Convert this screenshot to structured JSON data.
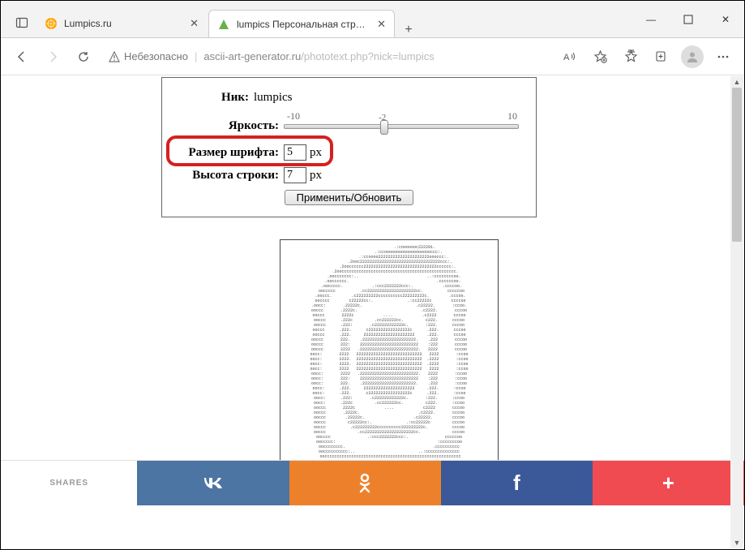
{
  "tabs": [
    {
      "title": "Lumpics.ru",
      "active": false
    },
    {
      "title": "lumpics Персональная странич",
      "active": true
    }
  ],
  "newtab_glyph": "+",
  "window": {
    "min": "—",
    "max": "▢",
    "close": "✕"
  },
  "toolbar": {
    "insecure": "Небезопасно",
    "url_host": "ascii-art-generator.ru",
    "url_path": "/phototext.php?nick=lumpics"
  },
  "form": {
    "nick_label": "Ник:",
    "nick_value": "lumpics",
    "brightness_label": "Яркость:",
    "brightness_min": "-10",
    "brightness_max": "10",
    "brightness_value": "-2",
    "fontsize_label": "Размер шрифта:",
    "fontsize_value": "5",
    "px1": "px",
    "lineheight_label": "Высота строки:",
    "lineheight_value": "7",
    "px2": "px",
    "apply": "Применить/Обновить"
  },
  "share": {
    "label": "SHARES",
    "vk": "W",
    "ok": "ģ",
    "fb": "f",
    "plus": "+"
  }
}
